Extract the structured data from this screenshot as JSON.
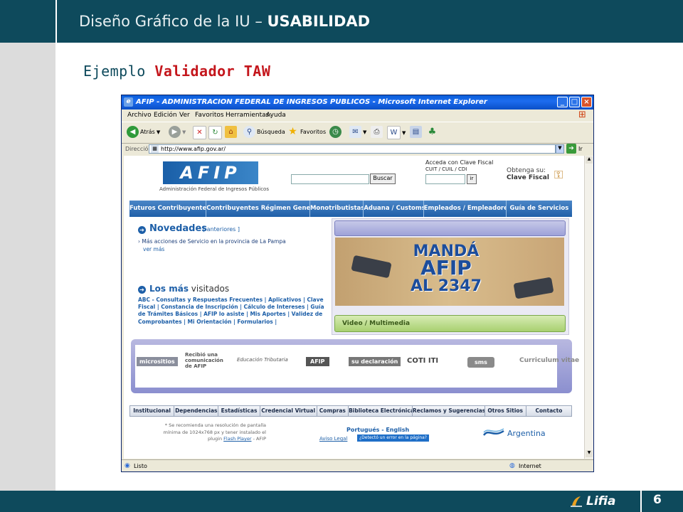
{
  "slide": {
    "title_prefix": "Diseño Gráfico de la IU – ",
    "title_bold": "USABILIDAD",
    "subtitle_prefix": "Ejemplo ",
    "subtitle_highlight": "Validador TAW",
    "page_number": "6",
    "logo_text": "Lifia"
  },
  "browser": {
    "title": "AFIP - ADMINISTRACION FEDERAL DE INGRESOS PUBLICOS - Microsoft Internet Explorer",
    "menu": [
      "Archivo",
      "Edición",
      "Ver",
      "Favoritos",
      "Herramientas",
      "Ayuda"
    ],
    "toolbar": {
      "back_label": "Atrás",
      "search_label": "Búsqueda",
      "favorites_label": "Favoritos"
    },
    "address_label": "Dirección",
    "address_value": "http://www.afip.gov.ar/",
    "go_label": "Ir",
    "status_text": "Listo",
    "zone_text": "Internet"
  },
  "afip": {
    "logo": "AFIP",
    "tagline": "Administración Federal de Ingresos Públicos",
    "search_button": "Buscar",
    "clave_title": "Acceda con Clave Fiscal",
    "clave_sub": "CUIT / CUIL / CDI",
    "clave_go": "ir",
    "obtenga_line1": "Obtenga su:",
    "obtenga_line2": "Clave Fiscal",
    "nav_main": [
      "Futuros Contribuyentes",
      "Contribuyentes Régimen General",
      "Monotributistas",
      "Aduana / Customs",
      "Empleados / Empleadores",
      "Guía de Servicios"
    ],
    "novedades_title": "Novedades",
    "novedades_link": "[ anteriores ]",
    "novedades_item": "Más acciones de Servicio en la provincia de La Pampa",
    "novedades_more": "ver más",
    "visitados_bold": "Los más",
    "visitados_rest": " visitados",
    "visitados_links": "ABC - Consultas y Respuestas Frecuentes | Aplicativos | Clave Fiscal | Constancia de Inscripción | Cálculo de Intereses | Guía de Trámites Básicos | AFIP lo asiste | Mis Aportes | Validez de Comprobantes | Mi Orientación | Formularios |",
    "promo_line1": "MANDÁ",
    "promo_line2": "AFIP",
    "promo_line3": "AL 2347",
    "video_label": "Video / Multimedia",
    "micro": [
      "micrositios",
      "Recibió una comunicación de AFIP",
      "Educación Tributaria",
      "AFIP",
      "su declaración",
      "COTI ITI",
      "sms",
      "Curriculum vitae"
    ],
    "nav_foot": [
      "Institucional",
      "Dependencias",
      "Estadísticas",
      "Credencial Virtual",
      "Compras",
      "Biblioteca Electrónica",
      "Reclamos y Sugerencias",
      "Otros Sitios",
      "Contacto"
    ],
    "footnote_1": "* Se recomienda una resolución de pantalla mínima de 1024x768 px y tener instalado el plugin ",
    "footnote_link": "Flash Player",
    "footnote_2": " - AFIP",
    "lang_links": "Portugués - English",
    "aviso_legal": "Aviso Legal",
    "error_button": "¿Detectó un error en la página?",
    "argentina": "Argentina"
  },
  "colors": {
    "slide_bar": "#0e4a5c",
    "highlight": "#c4161c",
    "afip_blue": "#1d5fa8"
  }
}
